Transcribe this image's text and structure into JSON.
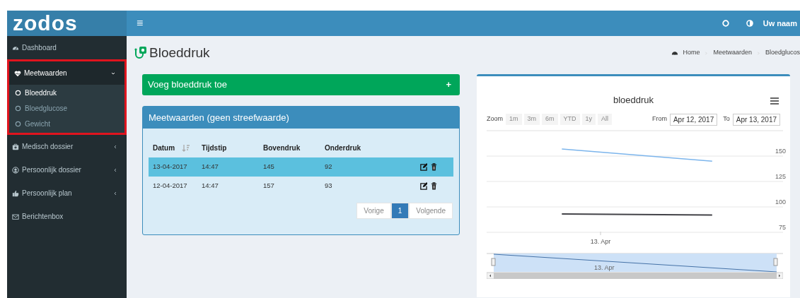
{
  "logo": "zodos",
  "topbar": {
    "menu_icon": "≡",
    "user": "Uw naam"
  },
  "sidebar": {
    "items": [
      {
        "label": "Dashboard",
        "kind": "link"
      },
      {
        "label": "Meetwaarden",
        "kind": "group",
        "expanded": true,
        "highlighted": true,
        "children": [
          {
            "label": "Bloeddruk",
            "selected": true
          },
          {
            "label": "Bloedglucose",
            "selected": false
          },
          {
            "label": "Gewicht",
            "selected": false
          }
        ]
      },
      {
        "label": "Medisch dossier",
        "kind": "group",
        "expanded": false,
        "highlighted": false
      },
      {
        "label": "Persoonlijk dossier",
        "kind": "group",
        "expanded": false,
        "highlighted": false
      },
      {
        "label": "Persoonlijk plan",
        "kind": "group",
        "expanded": false,
        "highlighted": false
      },
      {
        "label": "Berichtenbox",
        "kind": "link"
      }
    ]
  },
  "page_title": "Bloeddruk",
  "breadcrumb": [
    "Home",
    "Meetwaarden",
    "Bloedglucos"
  ],
  "add_box": {
    "title": "Voeg bloeddruk toe",
    "icon": "+"
  },
  "table_panel": {
    "title": "Meetwaarden (geen streefwaarde)",
    "columns": [
      "Datum",
      "Tijdstip",
      "Bovendruk",
      "Onderdruk"
    ],
    "rows": [
      {
        "selected": true,
        "cells": [
          "13-04-2017",
          "14:47",
          "145",
          "92"
        ]
      },
      {
        "selected": false,
        "cells": [
          "12-04-2017",
          "14:47",
          "157",
          "93"
        ]
      }
    ],
    "pagination": [
      {
        "label": "Vorige",
        "selected": false
      },
      {
        "label": "1",
        "selected": true
      },
      {
        "label": "Volgende",
        "selected": false
      }
    ]
  },
  "chart_panel": {
    "zoom_label": "Zoom",
    "zoom_buttons": [
      {
        "label": "1m",
        "disabled": true
      },
      {
        "label": "3m",
        "disabled": true
      },
      {
        "label": "6m",
        "disabled": true
      },
      {
        "label": "YTD",
        "disabled": true
      },
      {
        "label": "1y",
        "disabled": true
      },
      {
        "label": "All",
        "disabled": true
      }
    ],
    "from_label": "From",
    "from_value": "Apr 12, 2017",
    "to_label": "To",
    "to_value": "Apr 13, 2017",
    "navigator_label": "13. Apr",
    "chart_data": {
      "type": "line",
      "title": "bloeddruk",
      "categories": [
        null,
        null
      ],
      "grid": true,
      "series": [
        {
          "color": "#7cb5ec",
          "values": [
            157,
            145
          ]
        },
        {
          "color": "#434348",
          "values": [
            93,
            92
          ]
        }
      ],
      "ylim": [
        75,
        175
      ],
      "yticks": [
        {
          "value": 75,
          "label": "75"
        },
        {
          "value": 100,
          "label": "100"
        },
        {
          "value": 125,
          "label": "125"
        },
        {
          "value": 150,
          "label": "150"
        }
      ],
      "annotations": [
        {
          "text": "13. Apr"
        }
      ]
    }
  }
}
